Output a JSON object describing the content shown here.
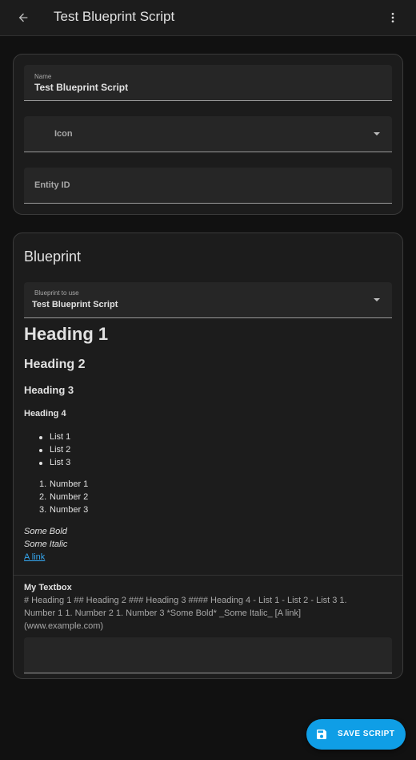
{
  "header": {
    "title": "Test Blueprint Script",
    "back_icon": "arrow-left-icon",
    "menu_icon": "dots-vertical-icon"
  },
  "settings_card": {
    "name_label": "Name",
    "name_value": "Test Blueprint Script",
    "icon_label": "Icon",
    "entity_id_label": "Entity ID"
  },
  "blueprint_card": {
    "title": "Blueprint",
    "blueprint_label": "Blueprint to use",
    "blueprint_value": "Test Blueprint Script",
    "description": {
      "h1": "Heading 1",
      "h2": "Heading 2",
      "h3": "Heading 3",
      "h4": "Heading 4",
      "list": [
        "List 1",
        "List 2",
        "List 3"
      ],
      "numbered": [
        "Number 1",
        "Number 2",
        "Number 3"
      ],
      "numbered_markers": [
        "1.",
        "2.",
        "3."
      ],
      "bold": "Some Bold",
      "italic": "Some Italic",
      "link": "A link"
    },
    "textbox": {
      "label": "My Textbox",
      "description": "# Heading 1 ## Heading 2 ### Heading 3 #### Heading 4 - List 1 - List 2 - List 3 1. Number 1 1. Number 2 1. Number 3 *Some Bold* _Some Italic_ [A link](www.example.com)",
      "value": ""
    }
  },
  "fab": {
    "label": "SAVE SCRIPT",
    "icon": "content-save-icon",
    "color": "#0f9ee6"
  }
}
